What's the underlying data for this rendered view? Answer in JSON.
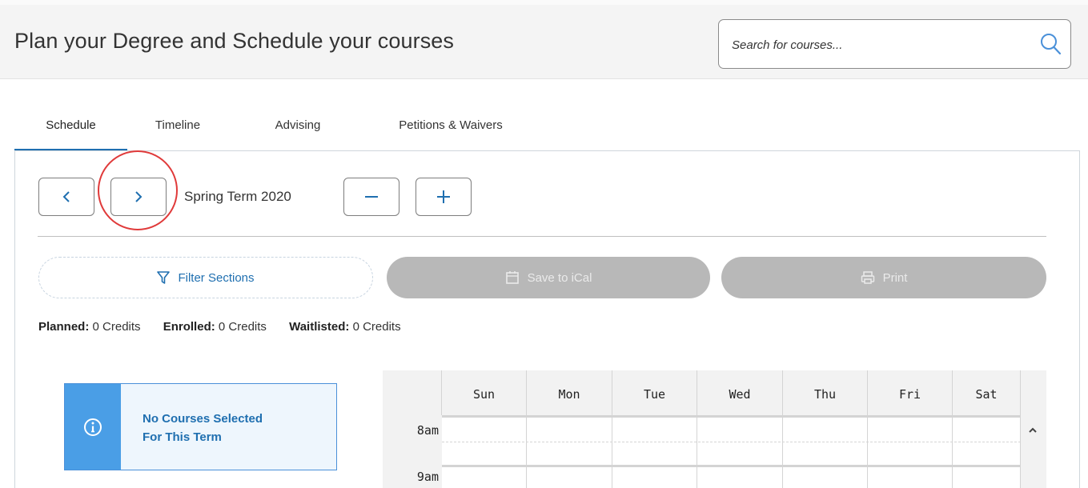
{
  "header": {
    "title": "Plan your Degree and Schedule your courses",
    "search_placeholder": "Search for courses..."
  },
  "tabs": [
    {
      "label": "Schedule",
      "active": true
    },
    {
      "label": "Timeline",
      "active": false
    },
    {
      "label": "Advising",
      "active": false
    },
    {
      "label": "Petitions & Waivers",
      "active": false
    }
  ],
  "term_nav": {
    "prev_icon": "chevron-left-icon",
    "next_icon": "chevron-right-icon",
    "term": "Spring Term 2020",
    "collapse_icon": "minus-icon",
    "expand_icon": "plus-icon"
  },
  "actions": {
    "filter_label": "Filter Sections",
    "ical_label": "Save to iCal",
    "print_label": "Print"
  },
  "credits": {
    "planned_label": "Planned:",
    "planned_value": "0 Credits",
    "enrolled_label": "Enrolled:",
    "enrolled_value": "0 Credits",
    "waitlisted_label": "Waitlisted:",
    "waitlisted_value": "0 Credits"
  },
  "notice": {
    "line1": "No Courses Selected",
    "line2": "For This Term"
  },
  "calendar": {
    "days": [
      "Sun",
      "Mon",
      "Tue",
      "Wed",
      "Thu",
      "Fri",
      "Sat"
    ],
    "times": [
      "8am",
      "9am"
    ]
  },
  "colors": {
    "accent": "#1f6fb0",
    "notice_side": "#4a9ee6",
    "disabled_button": "#b8b8b8",
    "annotation": "#e03a3a"
  }
}
